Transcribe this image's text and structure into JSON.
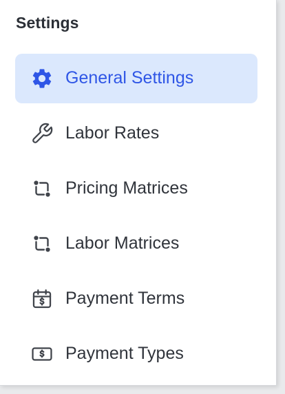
{
  "panel": {
    "heading": "Settings"
  },
  "nav": {
    "items": [
      {
        "label": "General Settings",
        "icon": "gear-icon",
        "active": true
      },
      {
        "label": "Labor Rates",
        "icon": "wrench-icon",
        "active": false
      },
      {
        "label": "Pricing Matrices",
        "icon": "matrix-icon",
        "active": false
      },
      {
        "label": "Labor Matrices",
        "icon": "matrix-icon",
        "active": false
      },
      {
        "label": "Payment Terms",
        "icon": "calendar-dollar-icon",
        "active": false
      },
      {
        "label": "Payment Types",
        "icon": "banknote-icon",
        "active": false
      }
    ]
  },
  "colors": {
    "accent": "#2f56e6",
    "active_background": "#dbe8fd",
    "text": "#30343b",
    "icon": "#40444b"
  }
}
